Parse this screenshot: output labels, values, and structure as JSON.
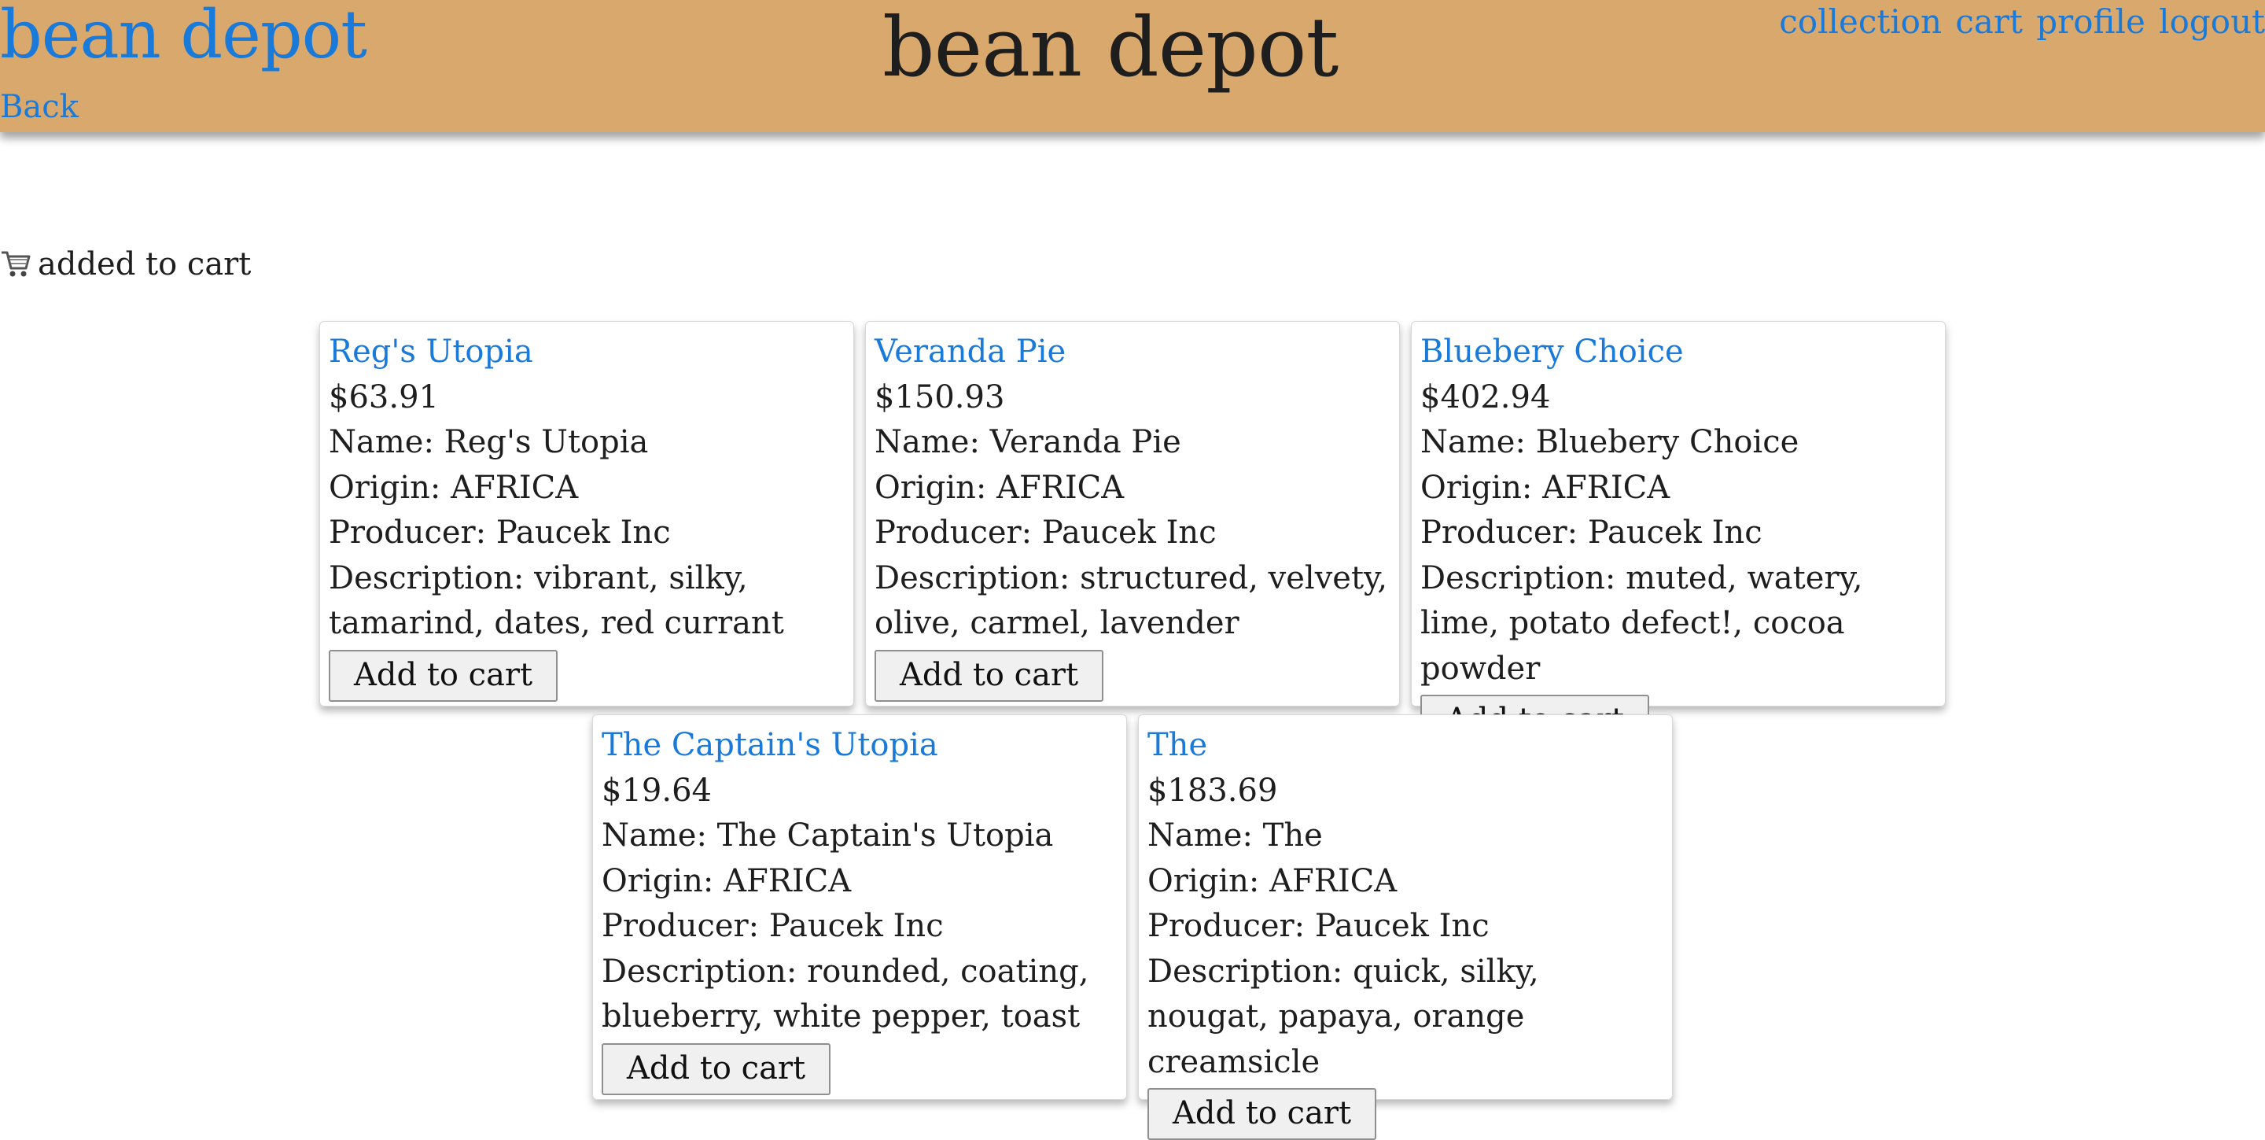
{
  "header": {
    "brand": "bean depot",
    "back": "Back",
    "title": "bean depot",
    "nav": [
      "collection",
      "cart",
      "profile",
      "logout"
    ]
  },
  "flash": {
    "icon": "cart-icon",
    "text": "added to cart"
  },
  "labels": {
    "name": "Name: ",
    "origin": "Origin: ",
    "producer": "Producer: ",
    "description": "Description: ",
    "add_to_cart": "Add to cart"
  },
  "products": [
    {
      "title": "Reg's Utopia",
      "price": "$63.91",
      "name": "Reg's Utopia",
      "origin": "AFRICA",
      "producer": "Paucek Inc",
      "description": "vibrant, silky, tamarind, dates, red currant"
    },
    {
      "title": "Veranda Pie",
      "price": "$150.93",
      "name": "Veranda Pie",
      "origin": "AFRICA",
      "producer": "Paucek Inc",
      "description": "structured, velvety, olive, carmel, lavender"
    },
    {
      "title": "Bluebery Choice",
      "price": "$402.94",
      "name": "Bluebery Choice",
      "origin": "AFRICA",
      "producer": "Paucek Inc",
      "description": "muted, watery, lime, potato defect!, cocoa powder"
    },
    {
      "title": "The Captain's Utopia",
      "price": "$19.64",
      "name": "The Captain's Utopia",
      "origin": "AFRICA",
      "producer": "Paucek Inc",
      "description": "rounded, coating, blueberry, white pepper, toast"
    },
    {
      "title": "The",
      "price": "$183.69",
      "name": "The",
      "origin": "AFRICA",
      "producer": "Paucek Inc",
      "description": "quick, silky, nougat, papaya, orange creamsicle"
    }
  ],
  "colors": {
    "header_bg": "#d9a86d",
    "link": "#1a7ad9",
    "text": "#1e1e1e"
  }
}
